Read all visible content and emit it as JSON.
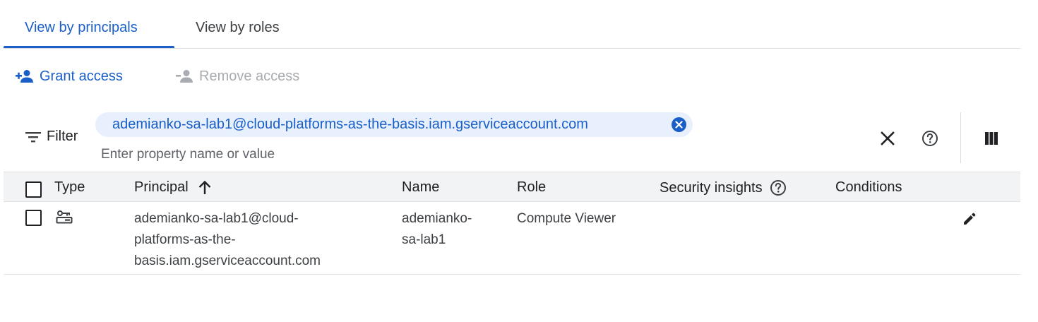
{
  "tabs": [
    {
      "label": "View by principals",
      "active": true
    },
    {
      "label": "View by roles",
      "active": false
    }
  ],
  "actions": {
    "grant_label": "Grant access",
    "remove_label": "Remove access"
  },
  "filter": {
    "label": "Filter",
    "chip_value": "ademianko-sa-lab1@cloud-platforms-as-the-basis.iam.gserviceaccount.com",
    "placeholder": "Enter property name or value"
  },
  "table": {
    "columns": {
      "type": "Type",
      "principal": "Principal",
      "name": "Name",
      "role": "Role",
      "security_insights": "Security insights",
      "conditions": "Conditions"
    },
    "sort": {
      "column": "Principal",
      "direction": "ascending"
    },
    "rows": [
      {
        "type_icon": "service-account-icon",
        "principal_lines": [
          "ademianko-sa-lab1@cloud-",
          "platforms-as-the-",
          "basis.iam.gserviceaccount.com"
        ],
        "name_lines": [
          "ademianko-",
          "sa-lab1"
        ],
        "role": "Compute Viewer",
        "security_insights": "",
        "conditions": ""
      }
    ]
  },
  "colors": {
    "accent": "#1a5fc8",
    "chip_bg": "#e8f0fe",
    "header_bg": "#f1f3f4",
    "disabled": "#a8abb0"
  }
}
